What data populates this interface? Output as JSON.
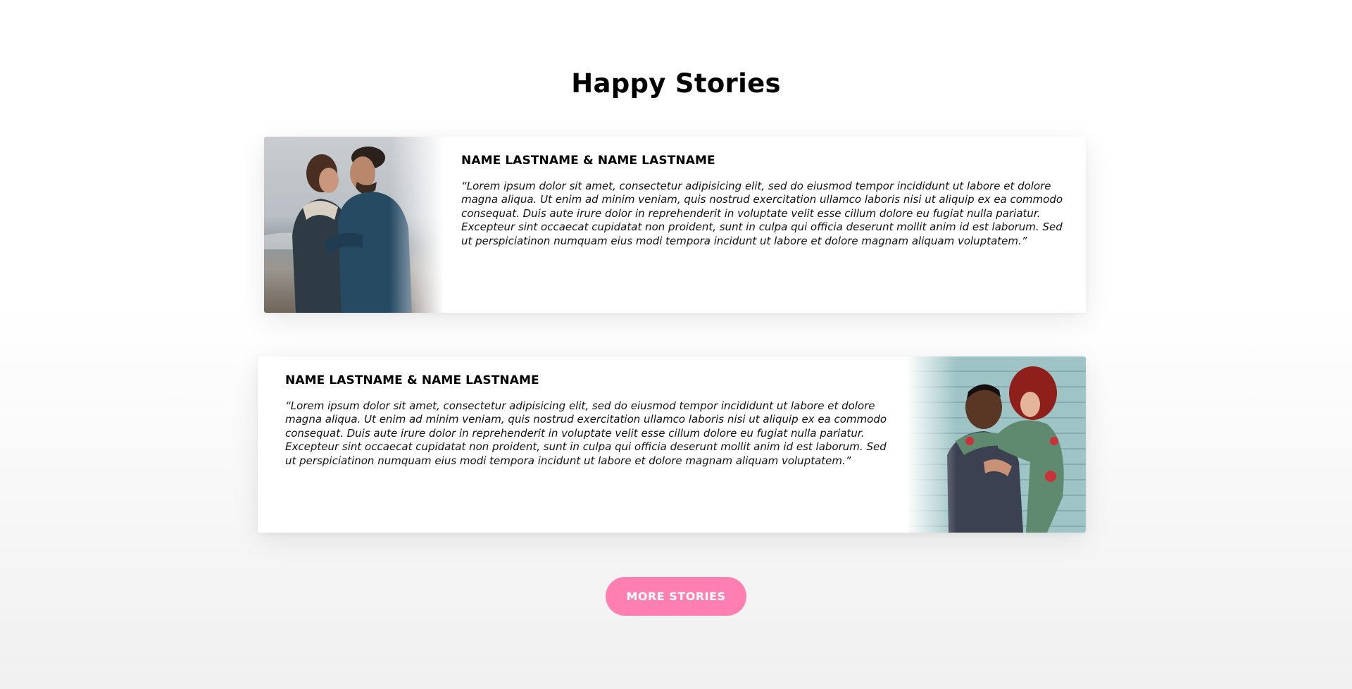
{
  "section": {
    "title": "Happy Stories"
  },
  "stories": [
    {
      "names": "NAME LASTNAME & NAME LASTNAME",
      "quote": "“Lorem ipsum dolor sit amet, consectetur adipisicing elit, sed do eiusmod tempor incididunt ut labore et dolore magna aliqua. Ut enim ad minim veniam, quis nostrud exercitation ullamco laboris nisi ut aliquip ex ea commodo consequat. Duis aute irure dolor in reprehenderit in voluptate velit esse cillum dolore eu fugiat nulla pariatur. Excepteur sint occaecat cupidatat non proident, sunt in culpa qui officia deserunt mollit anim id est laborum. Sed ut perspiciatinon numquam eius modi tempora incidunt ut labore et dolore magnam aliquam voluptatem.”",
      "photo_position": "left"
    },
    {
      "names": "NAME LASTNAME & NAME LASTNAME",
      "quote": "“Lorem ipsum dolor sit amet, consectetur adipisicing elit, sed do eiusmod tempor incididunt ut labore et dolore magna aliqua. Ut enim ad minim veniam, quis nostrud exercitation ullamco laboris nisi ut aliquip ex ea commodo consequat. Duis aute irure dolor in reprehenderit in voluptate velit esse cillum dolore eu fugiat nulla pariatur. Excepteur sint occaecat cupidatat non proident, sunt in culpa qui officia deserunt mollit anim id est laborum. Sed ut perspiciatinon numquam eius modi tempora incidunt ut labore et dolore magnam aliquam voluptatem.”",
      "photo_position": "right"
    }
  ],
  "more_button": {
    "label": "MORE STORIES"
  },
  "colors": {
    "accent": "#ff7fb3",
    "title": "#000000",
    "card_background": "#ffffff"
  }
}
